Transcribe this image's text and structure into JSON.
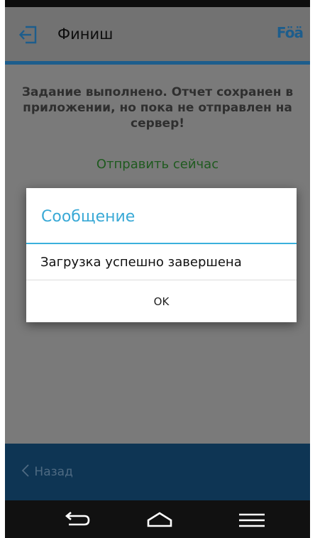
{
  "header": {
    "title": "Финиш",
    "logo_text": "Föä",
    "exit_icon": "exit-icon",
    "accent_color": "#1d5d8c"
  },
  "main": {
    "status_message": "Задание выполнено. Отчет сохранен в приложении, но пока не отправлен на сервер!",
    "send_now_link": "Отправить сейчас"
  },
  "dialog": {
    "title": "Сообщение",
    "message": "Загрузка успешно завершена",
    "ok_button": "OK",
    "title_color": "#39a9d6"
  },
  "footer": {
    "back_label": "Назад",
    "back_icon": "chevron-left-icon"
  },
  "system_nav": {
    "back_icon": "back-arrow-icon",
    "home_icon": "home-icon",
    "menu_icon": "menu-icon"
  }
}
